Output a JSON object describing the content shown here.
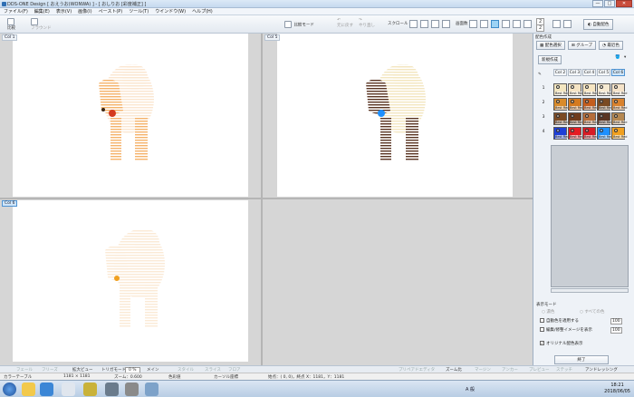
{
  "window": {
    "title": "DDS-ONE Design [ おえうお(WONWA) ] - [ おしりお [彩度補正] ]",
    "buttons": [
      "—",
      "□",
      "✕"
    ]
  },
  "menu": [
    "ファイル(F)",
    "編集(E)",
    "表示(V)",
    "画像(I)",
    "ペースト(P)",
    "ツール(T)",
    "ウインドウ(W)",
    "ヘルプ(H)"
  ],
  "toolbar": {
    "btn1": "比較",
    "btn2": "フラウンド",
    "compare_mode": "比較モード",
    "undo": "元に戻す",
    "redo": "やり直し",
    "scroll": "スクロール",
    "display": "画面数",
    "spin1": "2",
    "spin2": "2",
    "auto_color": "自動配色"
  },
  "panes": {
    "top_left": "Col 1",
    "top_right": "Col 5",
    "bottom_left": "Col 6"
  },
  "right_panel": {
    "title": "配色作成",
    "btn_color_select": "配色選択",
    "btn_group": "グループ",
    "btn_recent": "最近色",
    "btn_new": "新規作成",
    "columns": [
      "Col 2",
      "Col 3",
      "Col 4",
      "Col 5",
      "Col 6"
    ],
    "rows": [
      "1",
      "2",
      "3",
      "4"
    ],
    "swatch_label": "Best Red",
    "display_mode": "表示モード",
    "mode_a": "濃色",
    "mode_b": "すべての色",
    "chk_apply": "自動色を適用する",
    "chk_hide": "編集/修整イメージを表示",
    "chk_original": "オリジナル配色表示",
    "spin_a": "100",
    "spin_b": "100",
    "ok": "終了"
  },
  "bottom": {
    "items": [
      "フェール",
      "フリーズ",
      "拡大ビュー",
      "トリガモード",
      "0 %",
      "メイン",
      "スタイル",
      "スライス",
      "フロア"
    ],
    "right_items": [
      "プリペアドエディタ",
      "ズーム比",
      "マージン",
      "アンカー",
      "プレビュー",
      "ステッチ",
      "アンドレッシング"
    ],
    "status": {
      "color_table": "カラーテーブル",
      "size": "1181 × 1181",
      "zoom": "ズーム：0.600",
      "chromatic": "色彩値",
      "cursor": "カーソル座標",
      "coords": "始点：( 0, 0)，終点 X：1181，Y：1181"
    }
  },
  "taskbar": {
    "time": "18:21",
    "date": "2018/06/05",
    "ime": "A 般"
  },
  "colors": {
    "swatches": [
      [
        "#f3e6c0",
        "#f5e4c4",
        "#f7e6c2",
        "#f6ead2",
        "#f4e2c8"
      ],
      [
        "#d98b2a",
        "#d47a20",
        "#c45d1e",
        "#7a4a22",
        "#d9822e"
      ],
      [
        "#7b4a24",
        "#6f3b1c",
        "#b56d3b",
        "#5a3523",
        "#b58852"
      ],
      [
        "#1e3fd8",
        "#e51b23",
        "#d81b25",
        "#1e90ff",
        "#f0a020"
      ]
    ]
  }
}
